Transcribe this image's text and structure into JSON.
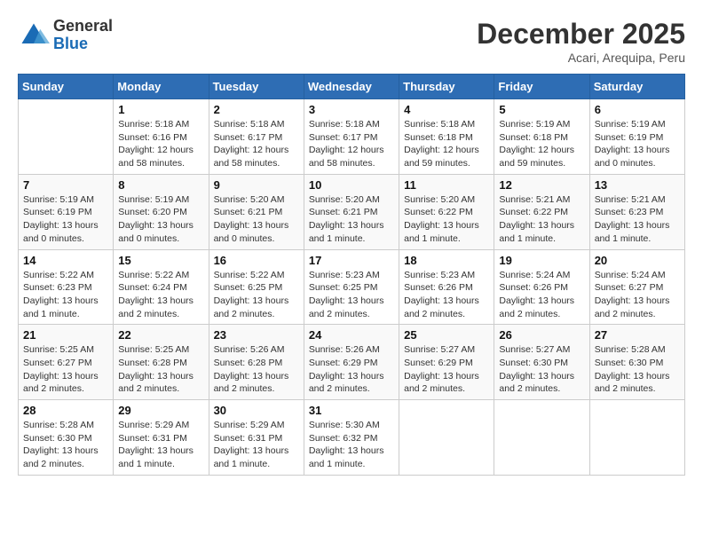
{
  "header": {
    "logo_general": "General",
    "logo_blue": "Blue",
    "month": "December 2025",
    "location": "Acari, Arequipa, Peru"
  },
  "days_of_week": [
    "Sunday",
    "Monday",
    "Tuesday",
    "Wednesday",
    "Thursday",
    "Friday",
    "Saturday"
  ],
  "weeks": [
    [
      {
        "day": "",
        "info": ""
      },
      {
        "day": "1",
        "info": "Sunrise: 5:18 AM\nSunset: 6:16 PM\nDaylight: 12 hours and 58 minutes."
      },
      {
        "day": "2",
        "info": "Sunrise: 5:18 AM\nSunset: 6:17 PM\nDaylight: 12 hours and 58 minutes."
      },
      {
        "day": "3",
        "info": "Sunrise: 5:18 AM\nSunset: 6:17 PM\nDaylight: 12 hours and 58 minutes."
      },
      {
        "day": "4",
        "info": "Sunrise: 5:18 AM\nSunset: 6:18 PM\nDaylight: 12 hours and 59 minutes."
      },
      {
        "day": "5",
        "info": "Sunrise: 5:19 AM\nSunset: 6:18 PM\nDaylight: 12 hours and 59 minutes."
      },
      {
        "day": "6",
        "info": "Sunrise: 5:19 AM\nSunset: 6:19 PM\nDaylight: 13 hours and 0 minutes."
      }
    ],
    [
      {
        "day": "7",
        "info": "Sunrise: 5:19 AM\nSunset: 6:19 PM\nDaylight: 13 hours and 0 minutes."
      },
      {
        "day": "8",
        "info": "Sunrise: 5:19 AM\nSunset: 6:20 PM\nDaylight: 13 hours and 0 minutes."
      },
      {
        "day": "9",
        "info": "Sunrise: 5:20 AM\nSunset: 6:21 PM\nDaylight: 13 hours and 0 minutes."
      },
      {
        "day": "10",
        "info": "Sunrise: 5:20 AM\nSunset: 6:21 PM\nDaylight: 13 hours and 1 minute."
      },
      {
        "day": "11",
        "info": "Sunrise: 5:20 AM\nSunset: 6:22 PM\nDaylight: 13 hours and 1 minute."
      },
      {
        "day": "12",
        "info": "Sunrise: 5:21 AM\nSunset: 6:22 PM\nDaylight: 13 hours and 1 minute."
      },
      {
        "day": "13",
        "info": "Sunrise: 5:21 AM\nSunset: 6:23 PM\nDaylight: 13 hours and 1 minute."
      }
    ],
    [
      {
        "day": "14",
        "info": "Sunrise: 5:22 AM\nSunset: 6:23 PM\nDaylight: 13 hours and 1 minute."
      },
      {
        "day": "15",
        "info": "Sunrise: 5:22 AM\nSunset: 6:24 PM\nDaylight: 13 hours and 2 minutes."
      },
      {
        "day": "16",
        "info": "Sunrise: 5:22 AM\nSunset: 6:25 PM\nDaylight: 13 hours and 2 minutes."
      },
      {
        "day": "17",
        "info": "Sunrise: 5:23 AM\nSunset: 6:25 PM\nDaylight: 13 hours and 2 minutes."
      },
      {
        "day": "18",
        "info": "Sunrise: 5:23 AM\nSunset: 6:26 PM\nDaylight: 13 hours and 2 minutes."
      },
      {
        "day": "19",
        "info": "Sunrise: 5:24 AM\nSunset: 6:26 PM\nDaylight: 13 hours and 2 minutes."
      },
      {
        "day": "20",
        "info": "Sunrise: 5:24 AM\nSunset: 6:27 PM\nDaylight: 13 hours and 2 minutes."
      }
    ],
    [
      {
        "day": "21",
        "info": "Sunrise: 5:25 AM\nSunset: 6:27 PM\nDaylight: 13 hours and 2 minutes."
      },
      {
        "day": "22",
        "info": "Sunrise: 5:25 AM\nSunset: 6:28 PM\nDaylight: 13 hours and 2 minutes."
      },
      {
        "day": "23",
        "info": "Sunrise: 5:26 AM\nSunset: 6:28 PM\nDaylight: 13 hours and 2 minutes."
      },
      {
        "day": "24",
        "info": "Sunrise: 5:26 AM\nSunset: 6:29 PM\nDaylight: 13 hours and 2 minutes."
      },
      {
        "day": "25",
        "info": "Sunrise: 5:27 AM\nSunset: 6:29 PM\nDaylight: 13 hours and 2 minutes."
      },
      {
        "day": "26",
        "info": "Sunrise: 5:27 AM\nSunset: 6:30 PM\nDaylight: 13 hours and 2 minutes."
      },
      {
        "day": "27",
        "info": "Sunrise: 5:28 AM\nSunset: 6:30 PM\nDaylight: 13 hours and 2 minutes."
      }
    ],
    [
      {
        "day": "28",
        "info": "Sunrise: 5:28 AM\nSunset: 6:30 PM\nDaylight: 13 hours and 2 minutes."
      },
      {
        "day": "29",
        "info": "Sunrise: 5:29 AM\nSunset: 6:31 PM\nDaylight: 13 hours and 1 minute."
      },
      {
        "day": "30",
        "info": "Sunrise: 5:29 AM\nSunset: 6:31 PM\nDaylight: 13 hours and 1 minute."
      },
      {
        "day": "31",
        "info": "Sunrise: 5:30 AM\nSunset: 6:32 PM\nDaylight: 13 hours and 1 minute."
      },
      {
        "day": "",
        "info": ""
      },
      {
        "day": "",
        "info": ""
      },
      {
        "day": "",
        "info": ""
      }
    ]
  ]
}
